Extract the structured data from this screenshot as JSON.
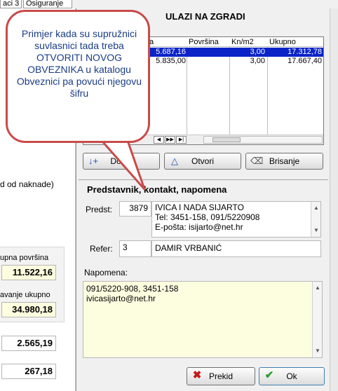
{
  "tabs": [
    {
      "label": "aci 3"
    },
    {
      "label": "Osiguranje"
    }
  ],
  "left": {
    "naknade_text": "d od naknade)",
    "label_povrsina": "upna površina",
    "value_povrsina": "11.522,16",
    "label_ukupno": "avanje ukupno",
    "value_ukupno": "34.980,18",
    "value_3": "2.565,19",
    "value_4": "267,18"
  },
  "ulazi": {
    "title": "ULAZI NA ZGRADI",
    "columns": [
      "a",
      "Površina",
      "Kn/m2",
      "Ukupno"
    ],
    "rows": [
      {
        "povrsina": "5.687,16",
        "knm2": "3,00",
        "ukupno": "17.312,78",
        "selected": true
      },
      {
        "povrsina": "5.835,00",
        "knm2": "3,00",
        "ukupno": "17.667,40",
        "selected": false
      }
    ]
  },
  "buttons": {
    "dodaj": "Dodaj",
    "otvori": "Otvori",
    "brisanje": "Brisanje",
    "prekid": "Prekid",
    "ok": "Ok"
  },
  "section_title": "Predstavnik, kontakt, napomena",
  "predst": {
    "label": "Predst:",
    "code": "3879",
    "lines": [
      "IVICA I NADA SIJARTO",
      "Tel: 3451-158, 091/5220908",
      "E-pošta: isijarto@net.hr"
    ]
  },
  "refer": {
    "label": "Refer:",
    "code": "3",
    "name": "DAMIR VRBANIĆ"
  },
  "napomena": {
    "label": "Napomena:",
    "lines": [
      "091/5220-908, 3451-158",
      "ivicasijarto@net.hr"
    ]
  },
  "callout": {
    "text": "Primjer kada su supružnici suvlasnici tada treba OTVORITI NOVOG OBVEZNIKA u katalogu Obveznici pa povući njegovu šifru"
  },
  "colors": {
    "callout_border": "#c84b49",
    "callout_text": "#1a3c85",
    "selection": "#0a24c8",
    "yellow_field": "#fdfde0"
  }
}
